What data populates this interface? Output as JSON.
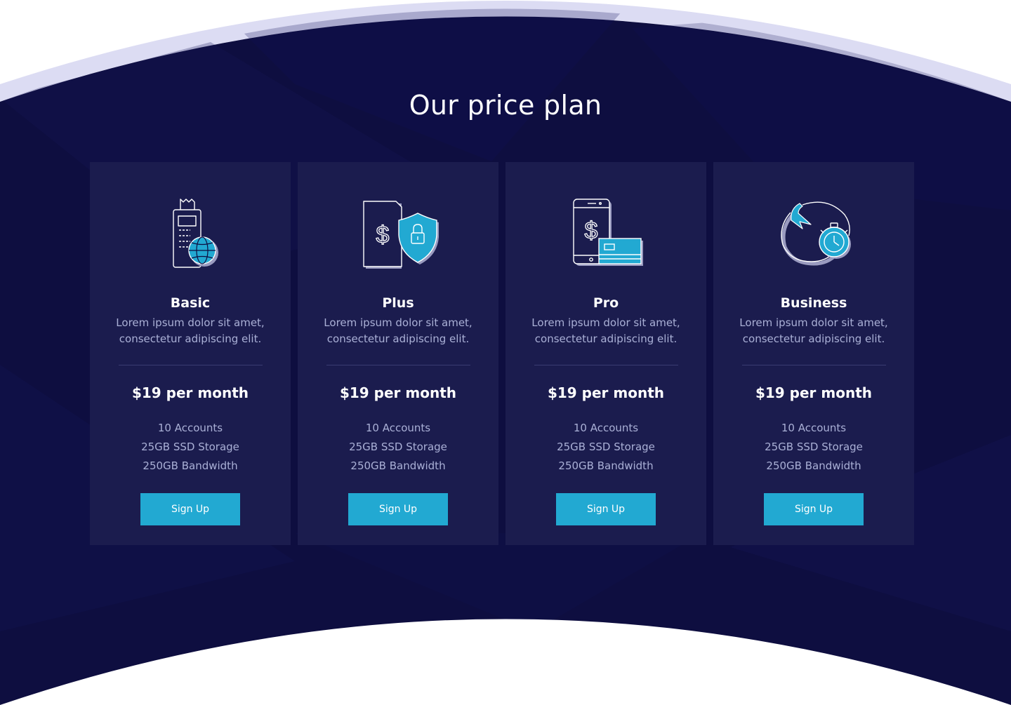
{
  "section": {
    "title": "Our price plan"
  },
  "colors": {
    "background": "#0e0e40",
    "card": "#1b1c4e",
    "accent": "#22a9d2",
    "rim": "#dcdcf3",
    "text_muted": "#aab0d6"
  },
  "plans": [
    {
      "name": "Basic",
      "icon": "payment-terminal-globe-icon",
      "description": "Lorem ipsum dolor sit amet, consectetur adipiscing elit.",
      "price": "$19 per month",
      "features": [
        "10 Accounts",
        "25GB SSD Storage",
        "250GB Bandwidth"
      ],
      "button": "Sign Up"
    },
    {
      "name": "Plus",
      "icon": "document-dollar-shield-icon",
      "description": "Lorem ipsum dolor sit amet, consectetur adipiscing elit.",
      "price": "$19 per month",
      "features": [
        "10 Accounts",
        "25GB SSD Storage",
        "250GB Bandwidth"
      ],
      "button": "Sign Up"
    },
    {
      "name": "Pro",
      "icon": "phone-dollar-card-icon",
      "description": "Lorem ipsum dolor sit amet, consectetur adipiscing elit.",
      "price": "$19 per month",
      "features": [
        "10 Accounts",
        "25GB SSD Storage",
        "250GB Bandwidth"
      ],
      "button": "Sign Up"
    },
    {
      "name": "Business",
      "icon": "clock-cycle-arrow-icon",
      "description": "Lorem ipsum dolor sit amet, consectetur adipiscing elit.",
      "price": "$19 per month",
      "features": [
        "10 Accounts",
        "25GB SSD Storage",
        "250GB Bandwidth"
      ],
      "button": "Sign Up"
    }
  ]
}
